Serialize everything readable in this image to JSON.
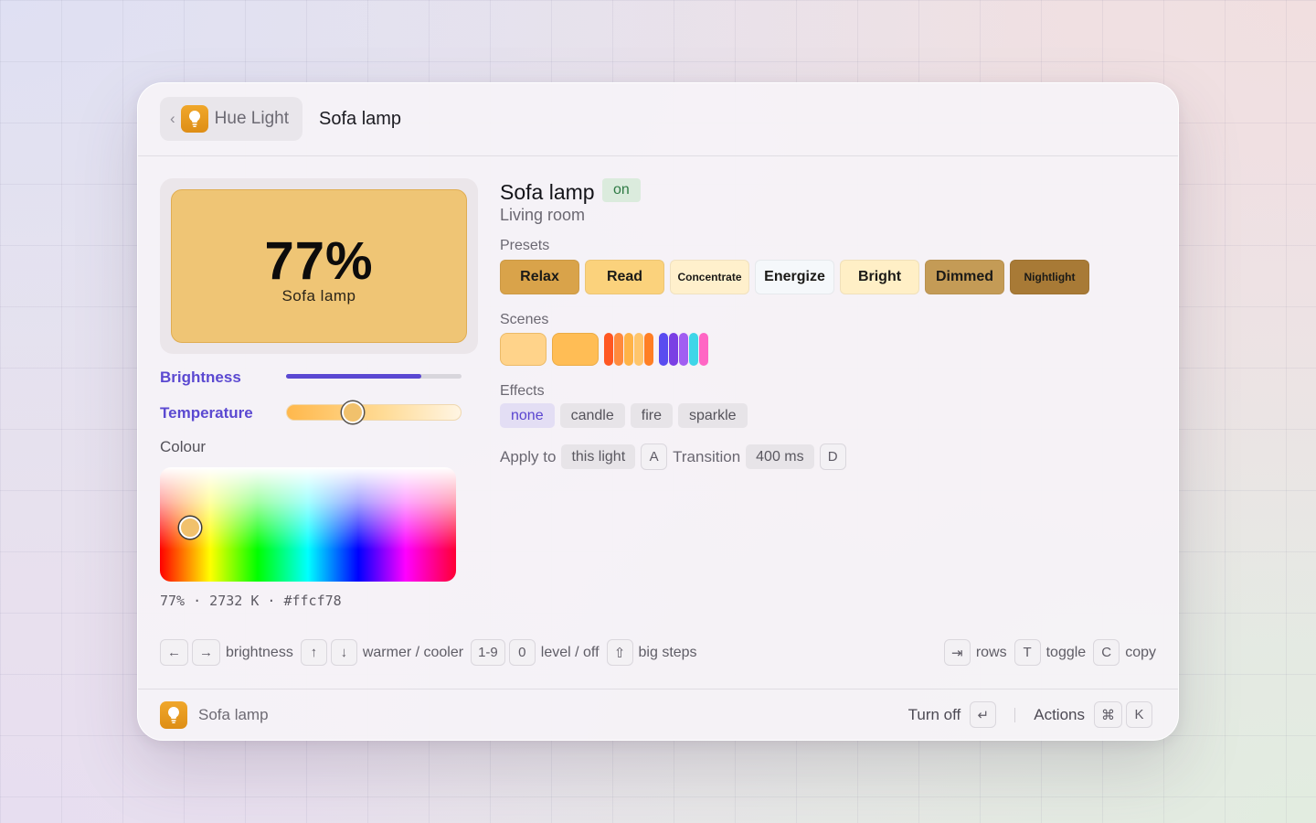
{
  "header": {
    "back_label": "Hue Light",
    "title": "Sofa lamp"
  },
  "preview": {
    "level": "77%",
    "name": "Sofa lamp",
    "color": "#efc575"
  },
  "controls": {
    "brightness_label": "Brightness",
    "brightness_value": 0.77,
    "temperature_label": "Temperature",
    "temperature_value": 0.38,
    "colour_label": "Colour",
    "readout": "77% · 2732 K · #ffcf78"
  },
  "light": {
    "name": "Sofa lamp",
    "status": "on",
    "room": "Living room"
  },
  "presets": {
    "label": "Presets",
    "items": [
      {
        "label": "Relax",
        "color": "#d9a34a",
        "size": "normal"
      },
      {
        "label": "Read",
        "color": "#fbd27c",
        "size": "normal"
      },
      {
        "label": "Concentrate",
        "color": "#fff0cc",
        "size": "small"
      },
      {
        "label": "Energize",
        "color": "#f5f8fb",
        "size": "normal"
      },
      {
        "label": "Bright",
        "color": "#ffefc6",
        "size": "normal"
      },
      {
        "label": "Dimmed",
        "color": "#c49b56",
        "size": "normal"
      },
      {
        "label": "Nightlight",
        "color": "#a87a36",
        "size": "small"
      }
    ]
  },
  "scenes": {
    "label": "Scenes",
    "swatches": [
      "#ffd38a",
      "#ffbd55"
    ],
    "stripe_groups": [
      [
        "#ff5722",
        "#ff8a3d",
        "#ffb347",
        "#ffc56b",
        "#ff7f24"
      ],
      [
        "#5a4cf0",
        "#7b3fe4",
        "#a15ef2",
        "#3fd6e8",
        "#ff66c4"
      ]
    ]
  },
  "effects": {
    "label": "Effects",
    "items": [
      {
        "label": "none",
        "active": true
      },
      {
        "label": "candle",
        "active": false
      },
      {
        "label": "fire",
        "active": false
      },
      {
        "label": "sparkle",
        "active": false
      }
    ]
  },
  "apply": {
    "label": "Apply to",
    "target": "this light",
    "target_key": "A",
    "transition_label": "Transition",
    "transition_value": "400 ms",
    "transition_key": "D"
  },
  "hints_left": {
    "left_key": "←",
    "right_key": "→",
    "brightness": "brightness",
    "up_key": "↑",
    "down_key": "↓",
    "temp": "warmer / cooler",
    "digits_key": "1-9",
    "zero_key": "0",
    "level": "level / off",
    "shift_key": "⇧",
    "big": "big steps"
  },
  "hints_right": {
    "tab_key": "⇥",
    "rows": "rows",
    "t_key": "T",
    "toggle": "toggle",
    "c_key": "C",
    "copy": "copy"
  },
  "footer": {
    "name": "Sofa lamp",
    "primary_action": "Turn off",
    "primary_key": "↵",
    "actions_label": "Actions",
    "cmd_key": "⌘",
    "k_key": "K"
  },
  "icons": {
    "app": "lightbulb-icon",
    "back": "chevron-left-icon"
  }
}
